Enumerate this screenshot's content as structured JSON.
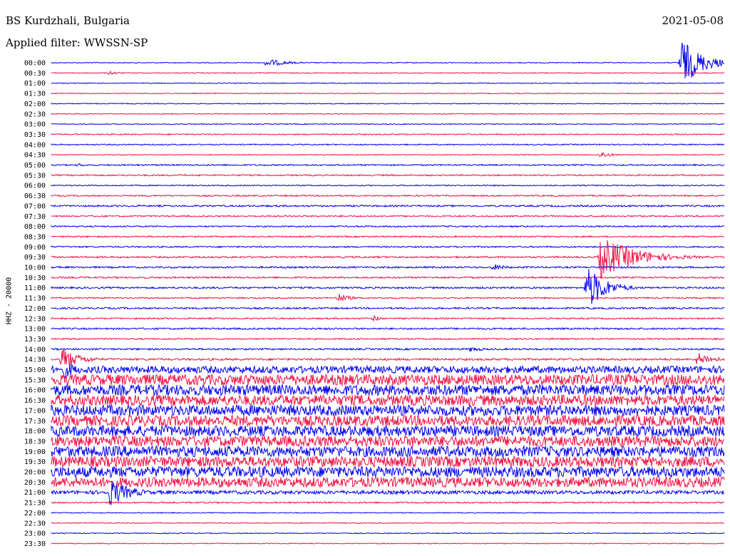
{
  "header": {
    "station": "BS Kurdzhali, Bulgaria",
    "filter": "Applied filter: WWSSN-SP",
    "date": "2021-05-08"
  },
  "channel_label": "HHZ - 20000",
  "colors": {
    "even": "#0000ee",
    "odd": "#ee1144"
  },
  "chart_data": {
    "type": "line",
    "title": "BS Kurdzhali, Bulgaria",
    "subtitle": "Applied filter: WWSSN-SP",
    "date": "2021-05-08",
    "ylabel": "HHZ - 20000",
    "x_unit": "minutes within 30-min row",
    "xlim": [
      0,
      30
    ],
    "rows": [
      "00:00",
      "00:30",
      "01:00",
      "01:30",
      "02:00",
      "02:30",
      "03:00",
      "03:30",
      "04:00",
      "04:30",
      "05:00",
      "05:30",
      "06:00",
      "06:30",
      "07:00",
      "07:30",
      "08:00",
      "08:30",
      "09:00",
      "09:30",
      "10:00",
      "10:30",
      "11:00",
      "11:30",
      "12:00",
      "12:30",
      "13:00",
      "13:30",
      "14:00",
      "14:30",
      "15:00",
      "15:30",
      "16:00",
      "16:30",
      "17:00",
      "17:30",
      "18:00",
      "18:30",
      "19:00",
      "19:30",
      "20:00",
      "20:30",
      "21:00",
      "21:30",
      "22:00",
      "22:30",
      "23:00",
      "23:30"
    ],
    "noise_level": [
      0.6,
      0.6,
      0.6,
      0.6,
      0.6,
      0.6,
      0.6,
      0.8,
      0.8,
      0.6,
      1.0,
      1.0,
      0.8,
      1.0,
      1.2,
      1.0,
      1.0,
      1.0,
      1.0,
      1.2,
      1.2,
      1.2,
      1.2,
      1.0,
      1.2,
      1.0,
      1.2,
      1.0,
      1.2,
      1.4,
      5.0,
      7.5,
      7.5,
      7.5,
      7.5,
      7.5,
      7.5,
      7.5,
      7.5,
      7.5,
      7.5,
      7.0,
      2.5,
      1.0,
      0.6,
      0.6,
      0.6,
      0.6
    ],
    "events": [
      {
        "row": "00:00",
        "minute": 9.6,
        "amplitude": 6,
        "duration_min": 1.4
      },
      {
        "row": "00:00",
        "minute": 28.1,
        "amplitude": 34,
        "duration_min": 1.5
      },
      {
        "row": "00:30",
        "minute": 2.6,
        "amplitude": 3,
        "duration_min": 0.7
      },
      {
        "row": "04:30",
        "minute": 24.5,
        "amplitude": 5,
        "duration_min": 0.8
      },
      {
        "row": "05:00",
        "minute": 1.2,
        "amplitude": 3,
        "duration_min": 0.5
      },
      {
        "row": "09:30",
        "minute": 24.5,
        "amplitude": 30,
        "duration_min": 2.5
      },
      {
        "row": "10:00",
        "minute": 19.7,
        "amplitude": 5,
        "duration_min": 1.0
      },
      {
        "row": "11:00",
        "minute": 23.9,
        "amplitude": 32,
        "duration_min": 1.3
      },
      {
        "row": "11:30",
        "minute": 12.8,
        "amplitude": 7,
        "duration_min": 0.8
      },
      {
        "row": "12:30",
        "minute": 14.4,
        "amplitude": 5,
        "duration_min": 0.5
      },
      {
        "row": "14:00",
        "minute": 18.7,
        "amplitude": 4,
        "duration_min": 1.0
      },
      {
        "row": "14:30",
        "minute": 0.5,
        "amplitude": 16,
        "duration_min": 1.3
      },
      {
        "row": "14:30",
        "minute": 28.8,
        "amplitude": 10,
        "duration_min": 1.2
      },
      {
        "row": "15:00",
        "minute": 0.6,
        "amplitude": 12,
        "duration_min": 1.3
      },
      {
        "row": "21:00",
        "minute": 2.6,
        "amplitude": 20,
        "duration_min": 1.5
      }
    ]
  }
}
